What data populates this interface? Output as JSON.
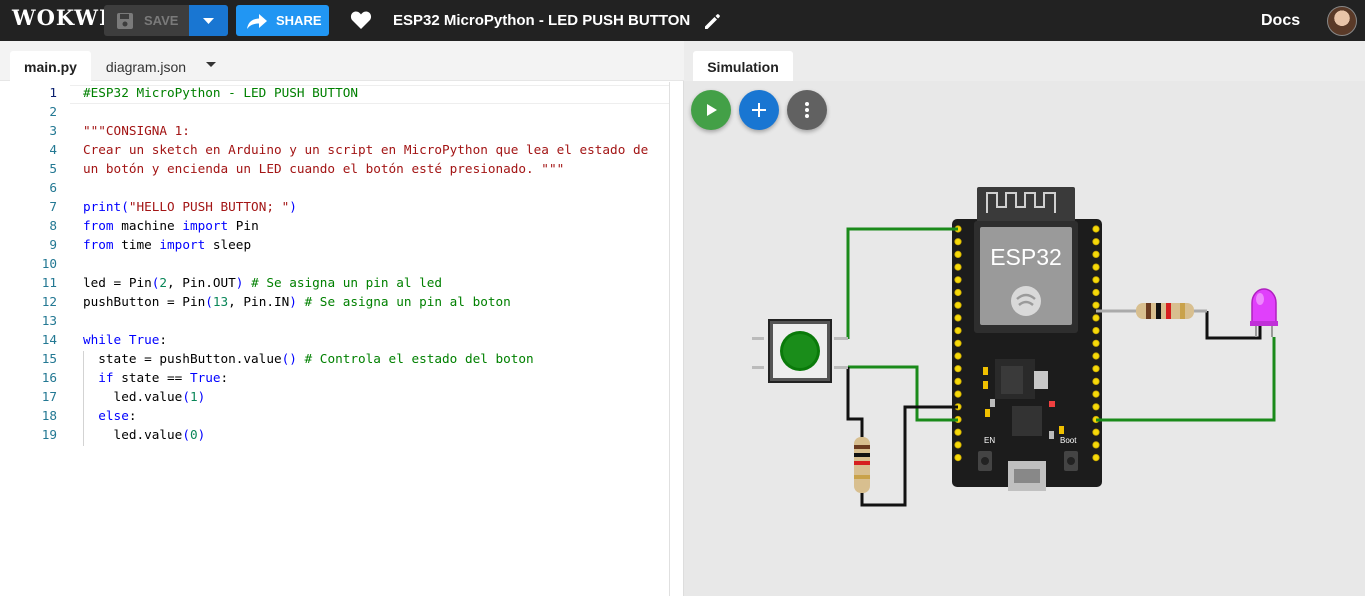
{
  "app": {
    "logo": "WOKWI"
  },
  "toolbar": {
    "save_label": "SAVE",
    "share_label": "SHARE"
  },
  "project": {
    "title": "ESP32 MicroPython - LED PUSH BUTTON"
  },
  "nav": {
    "docs_label": "Docs"
  },
  "editor": {
    "tabs": [
      {
        "label": "main.py",
        "active": true
      },
      {
        "label": "diagram.json",
        "active": false
      }
    ],
    "lines": [
      {
        "n": "1",
        "text": "#ESP32 MicroPython - LED PUSH BUTTON"
      },
      {
        "n": "2",
        "text": ""
      },
      {
        "n": "3",
        "text": "\"\"\"CONSIGNA 1:"
      },
      {
        "n": "4",
        "text": "Crear un sketch en Arduino y un script en MicroPython que lea el estado de"
      },
      {
        "n": "5",
        "text": "un botón y encienda un LED cuando el botón esté presionado. \"\"\""
      },
      {
        "n": "6",
        "text": ""
      },
      {
        "n": "7",
        "text": "print(\"HELLO PUSH BUTTON; \")"
      },
      {
        "n": "8",
        "text": "from machine import Pin"
      },
      {
        "n": "9",
        "text": "from time import sleep"
      },
      {
        "n": "10",
        "text": ""
      },
      {
        "n": "11",
        "text": "led = Pin(2, Pin.OUT) # Se asigna un pin al led"
      },
      {
        "n": "12",
        "text": "pushButton = Pin(13, Pin.IN) # Se asigna un pin al boton"
      },
      {
        "n": "13",
        "text": ""
      },
      {
        "n": "14",
        "text": "while True:"
      },
      {
        "n": "15",
        "text": "  state = pushButton.value() # Controla el estado del boton"
      },
      {
        "n": "16",
        "text": "  if state == True:"
      },
      {
        "n": "17",
        "text": "    led.value(1)"
      },
      {
        "n": "18",
        "text": "  else:"
      },
      {
        "n": "19",
        "text": "    led.value(0)"
      }
    ]
  },
  "simulation": {
    "tab_label": "Simulation",
    "board_label": "ESP32",
    "en_label": "EN",
    "boot_label": "Boot",
    "colors": {
      "run": "#43a047",
      "add": "#1976d2",
      "more": "#616161",
      "wire_green": "#1a8a1a",
      "led": "#e040fb"
    }
  },
  "colors": {
    "topbar": "#222222",
    "share": "#2196f3",
    "comment": "#008000",
    "string": "#a31515",
    "keyword": "#0000ff",
    "number": "#098658"
  }
}
